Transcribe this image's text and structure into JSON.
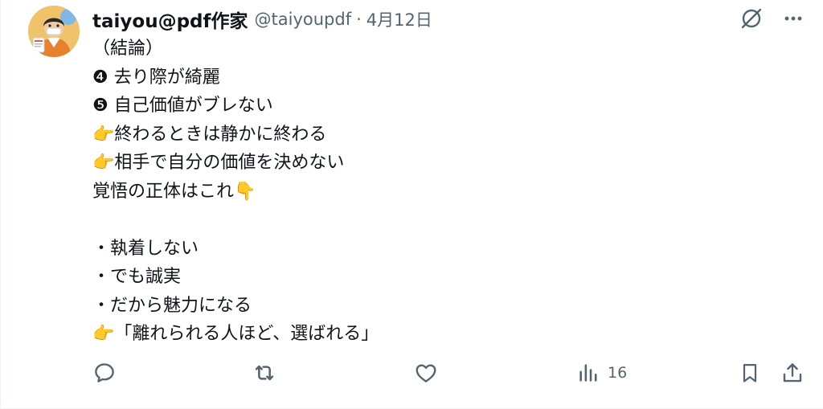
{
  "post": {
    "display_name": "taiyou@pdf作家",
    "handle": "@taiyoupdf",
    "separator": "·",
    "timestamp": "4月12日",
    "lines": [
      "（結論）",
      "❹ 去り際が綺麗",
      "❺ 自己価値がブレない",
      "👉終わるときは静かに終わる",
      "👉相手で自分の価値を決めない",
      "覚悟の正体はこれ👇",
      "",
      "・執着しない",
      "・でも誠実",
      "・だから魅力になる",
      "👉「離れられる人ほど、選ばれる」"
    ]
  },
  "actions": {
    "reply_icon": "reply-icon",
    "repost_icon": "repost-icon",
    "like_icon": "heart-icon",
    "views_icon": "analytics-icon",
    "views_count": "16",
    "bookmark_icon": "bookmark-icon",
    "share_icon": "share-icon"
  },
  "top_icons": [
    "grok-icon",
    "more-icon"
  ],
  "colors": {
    "text": "#0f1419",
    "secondary": "#536471",
    "border": "#eff3f4"
  }
}
